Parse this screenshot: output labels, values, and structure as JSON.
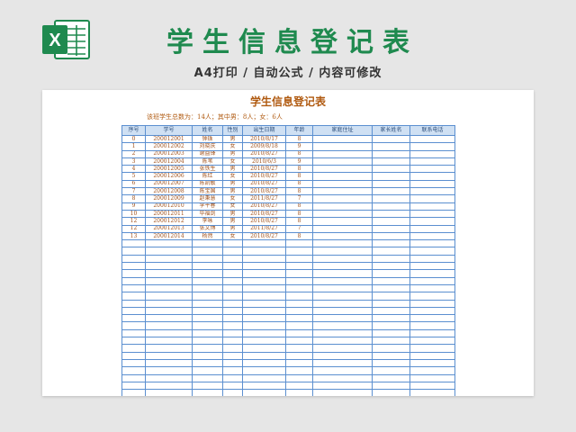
{
  "header": {
    "title": "学生信息登记表",
    "subtitle": "A4打印 / 自动公式 / 内容可修改",
    "logo_letter": "X",
    "brand_color": "#1f8a4f"
  },
  "sheet": {
    "title": "学生信息登记表",
    "summary": "该班学生总数为：14人；其中男：8人；女：6人",
    "columns": [
      "序号",
      "学号",
      "姓名",
      "性别",
      "出生日期",
      "年龄",
      "家庭住址",
      "家长姓名",
      "联系电话"
    ],
    "rows": [
      [
        "0",
        "200012001",
        "钟珠",
        "男",
        "2010/8/17",
        "8",
        "",
        "",
        ""
      ],
      [
        "1",
        "200012002",
        "刘晓庆",
        "女",
        "2009/8/18",
        "9",
        "",
        "",
        ""
      ],
      [
        "2",
        "200012003",
        "谢益锋",
        "男",
        "2010/8/27",
        "8",
        "",
        "",
        ""
      ],
      [
        "3",
        "200012004",
        "陈苇",
        "女",
        "2010/6/3",
        "9",
        "",
        "",
        ""
      ],
      [
        "4",
        "200012005",
        "张铁生",
        "男",
        "2010/8/27",
        "8",
        "",
        "",
        ""
      ],
      [
        "5",
        "200012006",
        "陈红",
        "女",
        "2010/8/27",
        "8",
        "",
        "",
        ""
      ],
      [
        "6",
        "200012007",
        "陈凯敏",
        "男",
        "2010/8/27",
        "8",
        "",
        "",
        ""
      ],
      [
        "7",
        "200012008",
        "陈宝国",
        "男",
        "2010/8/27",
        "8",
        "",
        "",
        ""
      ],
      [
        "8",
        "200012009",
        "赵秉慧",
        "女",
        "2011/8/27",
        "7",
        "",
        "",
        ""
      ],
      [
        "9",
        "200012010",
        "李平春",
        "女",
        "2010/8/27",
        "8",
        "",
        "",
        ""
      ],
      [
        "10",
        "200012011",
        "毕福剑",
        "男",
        "2010/8/27",
        "8",
        "",
        "",
        ""
      ],
      [
        "12",
        "200012012",
        "李咏",
        "男",
        "2010/8/27",
        "8",
        "",
        "",
        ""
      ],
      [
        "12",
        "200012013",
        "张文博",
        "男",
        "2011/8/27",
        "7",
        "",
        "",
        ""
      ],
      [
        "13",
        "200012014",
        "杨然",
        "女",
        "2010/8/27",
        "8",
        "",
        "",
        ""
      ]
    ],
    "empty_row_count": 22
  }
}
